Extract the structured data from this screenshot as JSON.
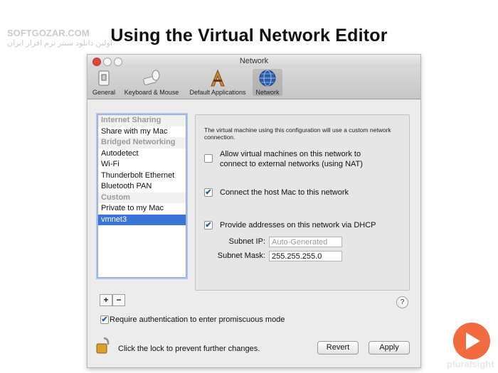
{
  "slide": {
    "title": "Using the Virtual Network Editor"
  },
  "watermark": {
    "line1": "SOFTGOZAR.COM",
    "line2": "اولین دانلود سنتر نرم افزار ایران"
  },
  "window": {
    "title": "Network"
  },
  "toolbar": {
    "items": [
      {
        "label": "General",
        "icon": "general-switch-icon"
      },
      {
        "label": "Keyboard & Mouse",
        "icon": "keyboard-mouse-icon"
      },
      {
        "label": "Default Applications",
        "icon": "default-applications-icon"
      },
      {
        "label": "Network",
        "icon": "network-globe-icon",
        "selected": true
      }
    ]
  },
  "network_list": {
    "rows": [
      {
        "label": "Internet Sharing",
        "type": "header"
      },
      {
        "label": "Share with my Mac",
        "type": "item"
      },
      {
        "label": "Bridged Networking",
        "type": "header"
      },
      {
        "label": "Autodetect",
        "type": "item"
      },
      {
        "label": "Wi-Fi",
        "type": "item"
      },
      {
        "label": "Thunderbolt Ethernet",
        "type": "item"
      },
      {
        "label": "Bluetooth PAN",
        "type": "item"
      },
      {
        "label": "Custom",
        "type": "header"
      },
      {
        "label": "Private to my Mac",
        "type": "item"
      },
      {
        "label": "vmnet3",
        "type": "item",
        "selected": true
      }
    ],
    "add_label": "+",
    "remove_label": "−"
  },
  "settings": {
    "description": "The virtual machine using this configuration will use a custom network connection.",
    "allow_nat": {
      "line1": "Allow virtual machines on this network to",
      "line2": "connect to external networks (using NAT)",
      "checked": false
    },
    "connect_host": {
      "label": "Connect the host Mac to this network",
      "checked": true
    },
    "dhcp": {
      "label": "Provide addresses on this network via DHCP",
      "checked": true
    },
    "subnet_ip": {
      "label": "Subnet IP:",
      "placeholder": "Auto-Generated",
      "value": ""
    },
    "subnet_mask": {
      "label": "Subnet Mask:",
      "value": "255.255.255.0"
    }
  },
  "footer": {
    "help_label": "?",
    "require_auth": {
      "label": "Require authentication to enter promiscuous mode",
      "checked": true
    },
    "lock_text": "Click the lock to prevent further changes.",
    "revert_label": "Revert",
    "apply_label": "Apply"
  },
  "branding": {
    "pluralsight_text": "pluralsight",
    "accent": "#f15b2a"
  },
  "check_mark": "✔"
}
